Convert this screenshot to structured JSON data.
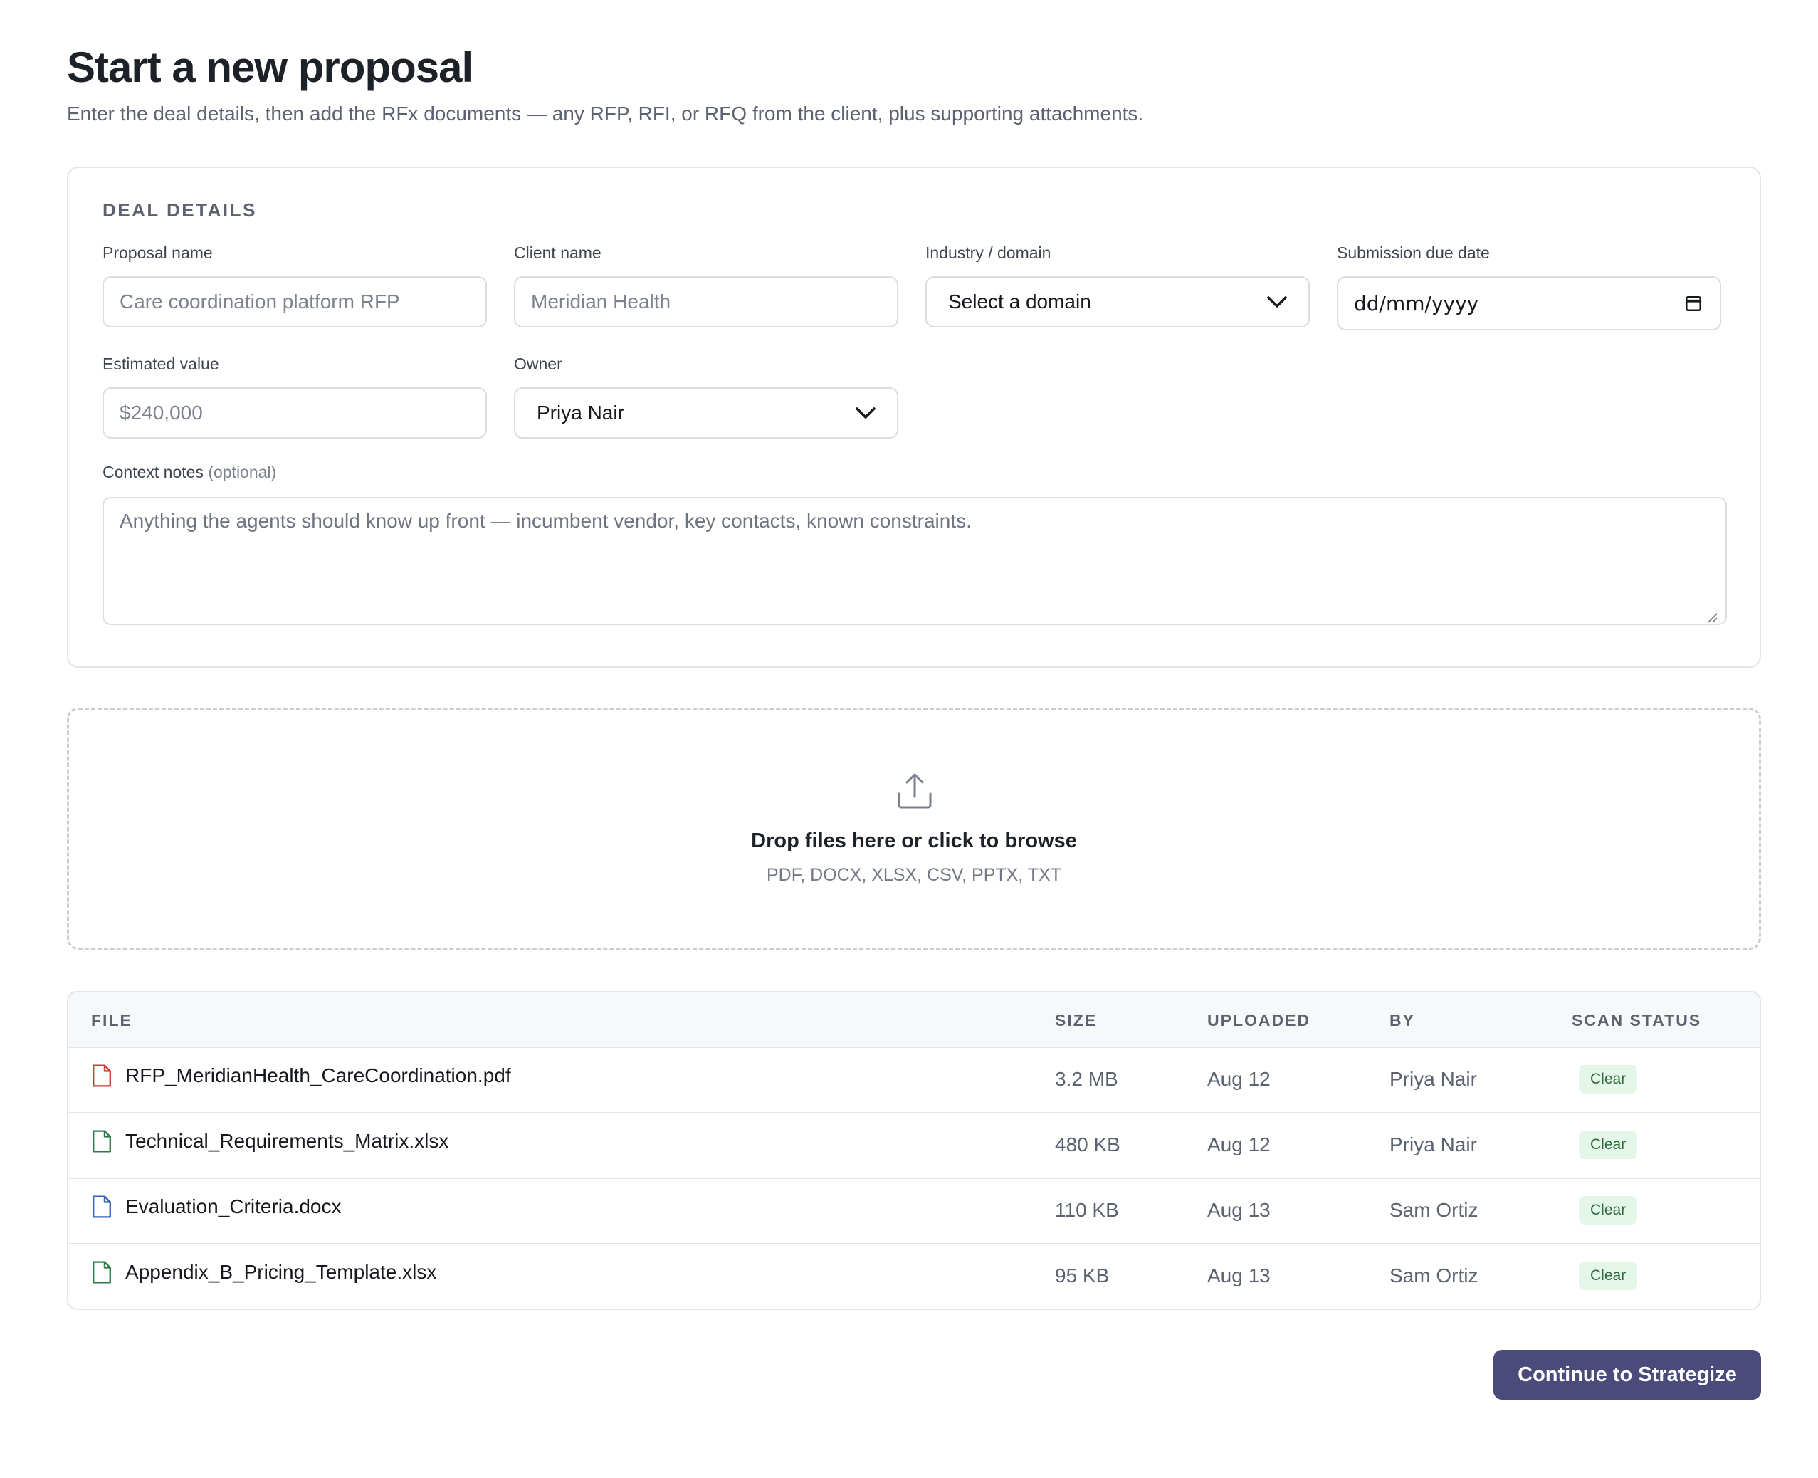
{
  "header": {
    "title": "Start a new proposal",
    "subtitle": "Enter the deal details, then add the RFx documents — any RFP, RFI, or RFQ from the client, plus supporting attachments."
  },
  "deal_details": {
    "section_title": "DEAL DETAILS",
    "proposal_name": {
      "label": "Proposal name",
      "placeholder": "Care coordination platform RFP"
    },
    "client_name": {
      "label": "Client name",
      "placeholder": "Meridian Health"
    },
    "industry": {
      "label": "Industry / domain",
      "value": "Select a domain"
    },
    "due_date": {
      "label": "Submission due date",
      "value": "dd/mm/yyyy"
    },
    "estimated_value": {
      "label": "Estimated value",
      "placeholder": "$240,000"
    },
    "owner": {
      "label": "Owner",
      "value": "Priya Nair"
    },
    "context_notes": {
      "label": "Context notes",
      "label_optional": "(optional)",
      "placeholder": "Anything the agents should know up front — incumbent vendor, key contacts, known constraints."
    }
  },
  "dropzone": {
    "title": "Drop files here or click to browse",
    "formats": "PDF, DOCX, XLSX, CSV, PPTX, TXT"
  },
  "files_table": {
    "columns": {
      "file": "FILE",
      "size": "SIZE",
      "uploaded": "UPLOADED",
      "by": "BY",
      "scan": "SCAN STATUS"
    },
    "rows": [
      {
        "name": "RFP_MeridianHealth_CareCoordination.pdf",
        "size": "3.2 MB",
        "uploaded": "Aug 12",
        "by": "Priya Nair",
        "status": "Clear",
        "icon": "file-pdf-icon",
        "icon_color": "#d13a32"
      },
      {
        "name": "Technical_Requirements_Matrix.xlsx",
        "size": "480 KB",
        "uploaded": "Aug 12",
        "by": "Priya Nair",
        "status": "Clear",
        "icon": "file-xlsx-icon",
        "icon_color": "#2f7a46"
      },
      {
        "name": "Evaluation_Criteria.docx",
        "size": "110 KB",
        "uploaded": "Aug 13",
        "by": "Sam Ortiz",
        "status": "Clear",
        "icon": "file-docx-icon",
        "icon_color": "#3563b8"
      },
      {
        "name": "Appendix_B_Pricing_Template.xlsx",
        "size": "95 KB",
        "uploaded": "Aug 13",
        "by": "Sam Ortiz",
        "status": "Clear",
        "icon": "file-xlsx-icon",
        "icon_color": "#2f7a46"
      }
    ]
  },
  "actions": {
    "continue_label": "Continue to Strategize"
  },
  "colors": {
    "accent": "#4a4b7a",
    "badge_bg": "#e3f6e8",
    "badge_text": "#2d6b3d"
  }
}
